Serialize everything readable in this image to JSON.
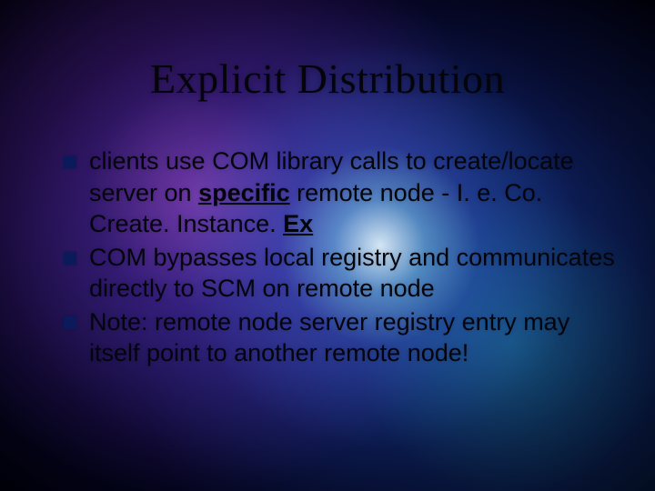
{
  "title": "Explicit Distribution",
  "bullets": [
    {
      "pre": "clients use COM library calls to create/locate server on ",
      "specific": "specific",
      "mid": " remote node  - I. e. Co. Create. Instance. ",
      "ex": "Ex",
      "post": ""
    },
    {
      "text": "COM bypasses local registry and communicates directly to SCM on remote node"
    },
    {
      "text": "Note: remote node server registry entry may itself point to another remote node!"
    }
  ]
}
